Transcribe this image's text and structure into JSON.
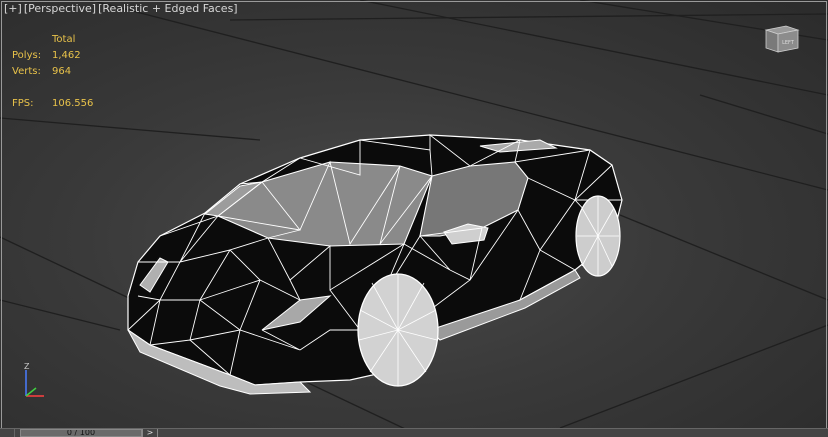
{
  "viewport": {
    "labels": [
      "[+]",
      "[Perspective]",
      "[Realistic + Edged Faces]"
    ]
  },
  "stats": {
    "total_label": "Total",
    "polys_label": "Polys:",
    "polys_value": "1,462",
    "verts_label": "Verts:",
    "verts_value": "964",
    "fps_label": "FPS:",
    "fps_value": "106.556"
  },
  "viewcube": {
    "face_label": "LEFT"
  },
  "axis": {
    "z_label": "Z"
  },
  "timeline": {
    "frame_text": "0 / 100",
    "next_arrow": ">"
  },
  "colors": {
    "stats_text": "#e8c24a",
    "wire": "#ffffff",
    "body": "#0a0a0a"
  }
}
